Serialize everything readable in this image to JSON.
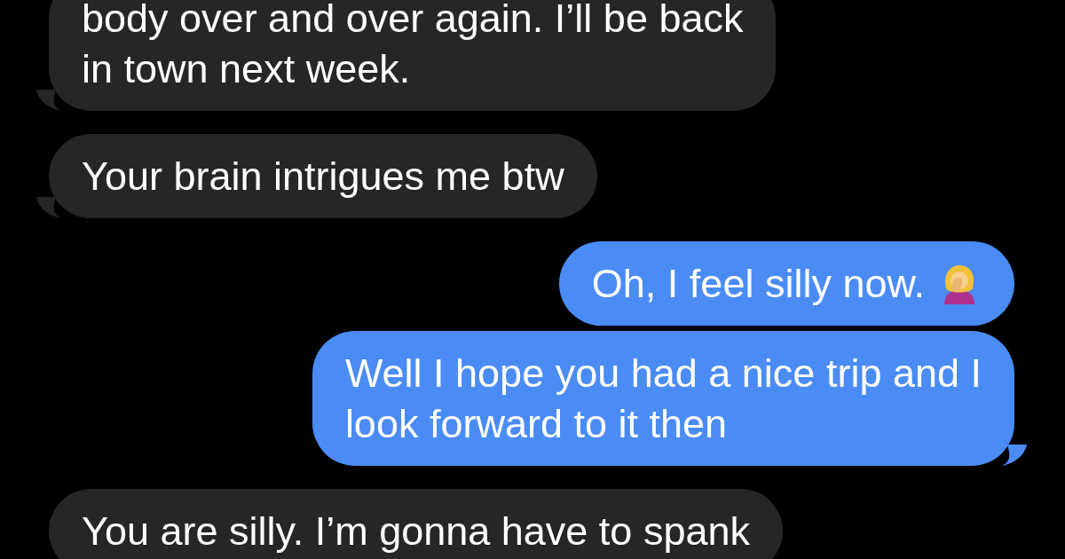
{
  "messages": [
    {
      "kind": "received",
      "text": "body over and over again. I’ll be back\nin town next week.",
      "tail": true,
      "emoji": false
    },
    {
      "kind": "received",
      "text": "Your brain intrigues me btw",
      "tail": true,
      "emoji": false
    },
    {
      "kind": "sent",
      "text": "Oh, I feel silly now.",
      "tail": false,
      "emoji": true
    },
    {
      "kind": "sent",
      "text": "Well I hope you had a nice trip and I\nlook forward to it then",
      "tail": true,
      "emoji": false
    },
    {
      "kind": "received",
      "text": "You are silly. I’m gonna have to spank",
      "tail": false,
      "emoji": false
    }
  ]
}
